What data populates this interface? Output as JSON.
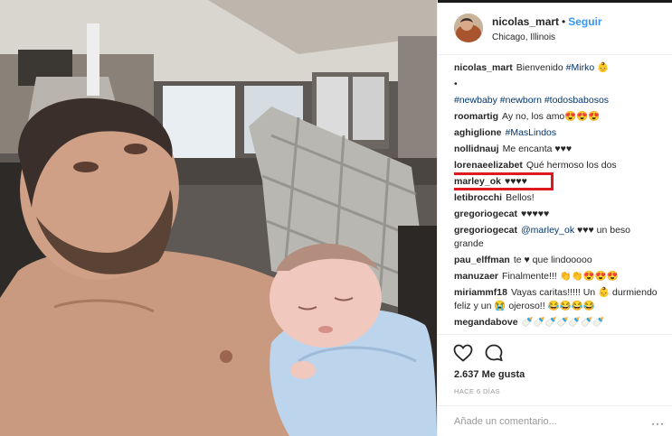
{
  "post": {
    "username": "nicolas_mart",
    "separator": "•",
    "follow_label": "Seguir",
    "location": "Chicago, Illinois"
  },
  "comments": [
    {
      "user": "nicolas_mart",
      "text": "Bienvenido ",
      "tag": "#Mirko",
      "after": " 👶"
    },
    {
      "user": "",
      "text": "•",
      "tag": "",
      "after": ""
    },
    {
      "user": "",
      "text": "",
      "tag": "#newbaby #newborn #todosbabosos",
      "after": ""
    },
    {
      "user": "roomartig",
      "text": "Ay no, los amo😍😍😍",
      "tag": "",
      "after": ""
    },
    {
      "user": "aghiglione",
      "text": "",
      "tag": "#MasLindos",
      "after": ""
    },
    {
      "user": "nollidnauj",
      "text": "Me encanta ♥♥♥",
      "tag": "",
      "after": ""
    },
    {
      "user": "lorenaeelizabet",
      "text": "Qué hermoso los dos",
      "tag": "",
      "after": ""
    },
    {
      "user": "marley_ok",
      "text": "♥♥♥♥",
      "tag": "",
      "after": ""
    },
    {
      "user": "letibrocchi",
      "text": "Bellos!",
      "tag": "",
      "after": ""
    },
    {
      "user": "gregoriogecat",
      "text": "♥♥♥♥♥",
      "tag": "",
      "after": ""
    },
    {
      "user": "gregoriogecat",
      "text": "",
      "tag": "@marley_ok",
      "after": " ♥♥♥ un beso grande"
    },
    {
      "user": "pau_elffman",
      "text": "te ♥ que lindooooo",
      "tag": "",
      "after": ""
    },
    {
      "user": "manuzaer",
      "text": "Finalmente!!! 👏👏😍😍😍",
      "tag": "",
      "after": ""
    },
    {
      "user": "miriammf18",
      "text": "Vayas caritas!!!!! Un 👶 durmiendo feliz y un 😭 ojeroso!! 😂😂😂😂",
      "tag": "",
      "after": ""
    },
    {
      "user": "megandabove",
      "text": "🍼🍼🍼🍼🍼🍼🍼",
      "tag": "",
      "after": ""
    }
  ],
  "highlighted_comment_index": 7,
  "actions": {
    "likes": "2.637 Me gusta",
    "time_ago": "HACE 6 DÍAS",
    "comment_placeholder": "Añade un comentario...",
    "more_label": "···"
  },
  "colors": {
    "follow": "#3897f0",
    "hashtag": "#003569",
    "highlight_box": "#e0191f"
  },
  "icons": [
    "heart-icon",
    "comment-bubble-icon",
    "more-options-icon"
  ]
}
